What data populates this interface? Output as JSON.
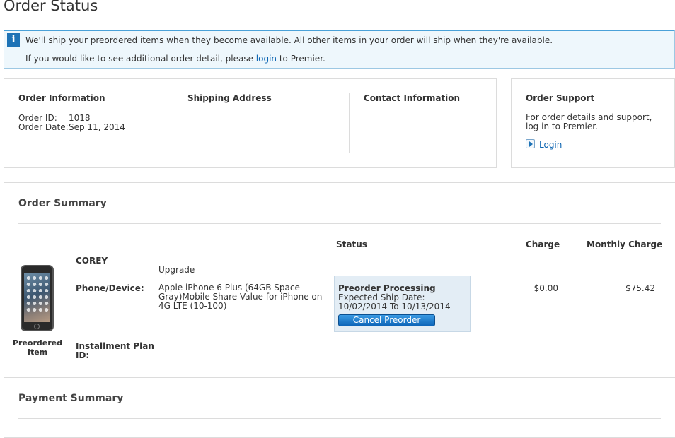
{
  "page": {
    "title": "Order Status"
  },
  "notice": {
    "line1": "We'll ship your preordered items when they become available. All other items in your order will ship when they're available.",
    "line2_before": "If you would like to see additional order detail, please",
    "line2_link": "login",
    "line2_after": "to Premier."
  },
  "order_info": {
    "heading": "Order Information",
    "order_id_label": "Order ID:",
    "order_id": "1018",
    "order_date_label": "Order Date:",
    "order_date": "Sep 11, 2014"
  },
  "shipping": {
    "heading": "Shipping Address"
  },
  "contact": {
    "heading": "Contact Information"
  },
  "support": {
    "heading": "Order Support",
    "text": "For order details and support, log in to Premier.",
    "login_label": "Login"
  },
  "summary": {
    "heading": "Order Summary",
    "col_status": "Status",
    "col_charge": "Charge",
    "col_monthly": "Monthly Charge",
    "item": {
      "caption": "Preordered Item",
      "name": "COREY",
      "type": "Upgrade",
      "device_label": "Phone/Device:",
      "device_value": "Apple iPhone 6 Plus (64GB Space Gray)Mobile Share Value for iPhone on 4G LTE (10-100)",
      "installment_label": "Installment Plan ID:",
      "status_title": "Preorder Processing",
      "expected_label": "Expected Ship Date:",
      "expected_range": "10/02/2014 To 10/13/2014",
      "cancel_label": "Cancel Preorder",
      "charge": "$0.00",
      "monthly_charge": "$75.42"
    }
  },
  "payment": {
    "heading": "Payment Summary"
  }
}
